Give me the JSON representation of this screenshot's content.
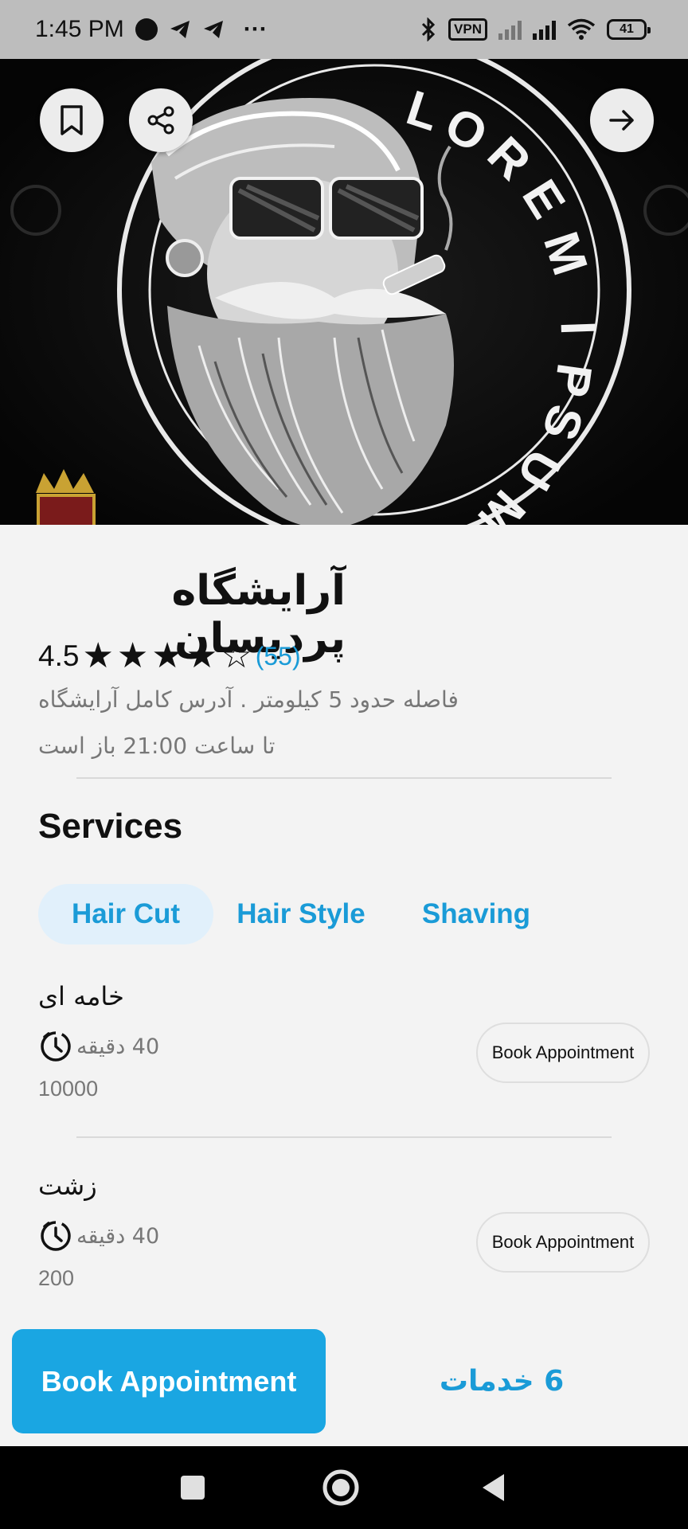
{
  "status_bar": {
    "time": "1:45 PM",
    "vpn_label": "VPN",
    "battery": "41",
    "more": "···"
  },
  "hero": {
    "logo_text": "LOREM IPSUM"
  },
  "shop": {
    "name": "آرایشگاه پردیسان",
    "rating": "4.5",
    "rating_value": 4.5,
    "review_count": "(55)",
    "distance": "فاصله حدود 5 کیلومتر . آدرس کامل آرایشگاه",
    "hours": "تا ساعت 21:00 باز است"
  },
  "services": {
    "title": "Services",
    "tabs": [
      {
        "label": "Hair Cut",
        "active": true
      },
      {
        "label": "Hair Style",
        "active": false
      },
      {
        "label": "Shaving",
        "active": false
      }
    ],
    "items": [
      {
        "name": "خامه ای",
        "duration": "40 دقیقه",
        "price": "10000",
        "button": "Book Appointment"
      },
      {
        "name": "زشت",
        "duration": "40 دقیقه",
        "price": "200",
        "button": "Book Appointment"
      }
    ]
  },
  "bottom": {
    "book_label": "Book Appointment",
    "services_count": "6 خدمات"
  },
  "colors": {
    "accent": "#1aa6e2",
    "link": "#1a9bd7",
    "tab_active_bg": "#e1f0fb"
  }
}
